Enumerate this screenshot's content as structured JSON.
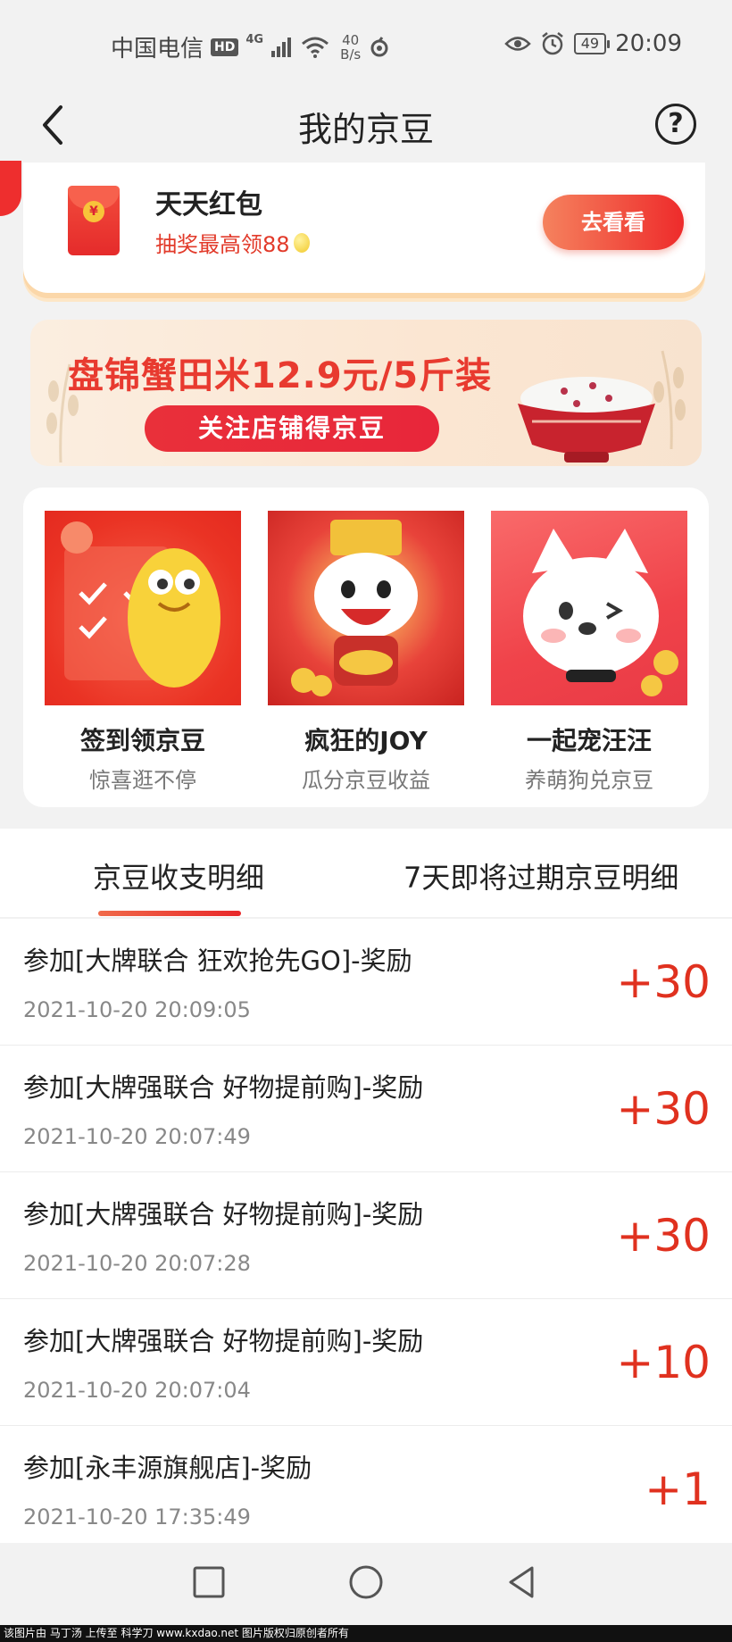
{
  "status_bar": {
    "carrier": "中国电信",
    "hd": "HD",
    "signal": "4G",
    "speed_value": "40",
    "speed_unit": "B/s",
    "battery": "49",
    "time": "20:09"
  },
  "nav": {
    "title": "我的京豆"
  },
  "hongbao": {
    "title": "天天红包",
    "subtitle": "抽奖最高领88",
    "button": "去看看",
    "coin_symbol": "¥"
  },
  "banner": {
    "title": "盘锦蟹田米12.9元/5斤装",
    "button": "关注店铺得京豆"
  },
  "games": [
    {
      "title": "签到领京豆",
      "subtitle": "惊喜逛不停"
    },
    {
      "title": "疯狂的JOY",
      "subtitle": "瓜分京豆收益"
    },
    {
      "title": "一起宠汪汪",
      "subtitle": "养萌狗兑京豆"
    }
  ],
  "tabs": [
    {
      "label": "京豆收支明细",
      "active": true
    },
    {
      "label": "7天即将过期京豆明细",
      "active": false
    }
  ],
  "records": [
    {
      "title": "参加[大牌联合  狂欢抢先GO]-奖励",
      "time": "2021-10-20 20:09:05",
      "amount": "+30"
    },
    {
      "title": "参加[大牌强联合 好物提前购]-奖励",
      "time": "2021-10-20 20:07:49",
      "amount": "+30"
    },
    {
      "title": "参加[大牌强联合 好物提前购]-奖励",
      "time": "2021-10-20 20:07:28",
      "amount": "+30"
    },
    {
      "title": "参加[大牌强联合 好物提前购]-奖励",
      "time": "2021-10-20 20:07:04",
      "amount": "+10"
    },
    {
      "title": "参加[永丰源旗舰店]-奖励",
      "time": "2021-10-20 17:35:49",
      "amount": "+1"
    }
  ],
  "watermark": "该图片由 马丁汤 上传至 科学刀 www.kxdao.net 图片版权归原创者所有",
  "colors": {
    "accent_red": "#e0311f",
    "button_gradient_start": "#f5825e",
    "button_gradient_end": "#ee2b2b",
    "page_bg": "#f2f2f2"
  }
}
